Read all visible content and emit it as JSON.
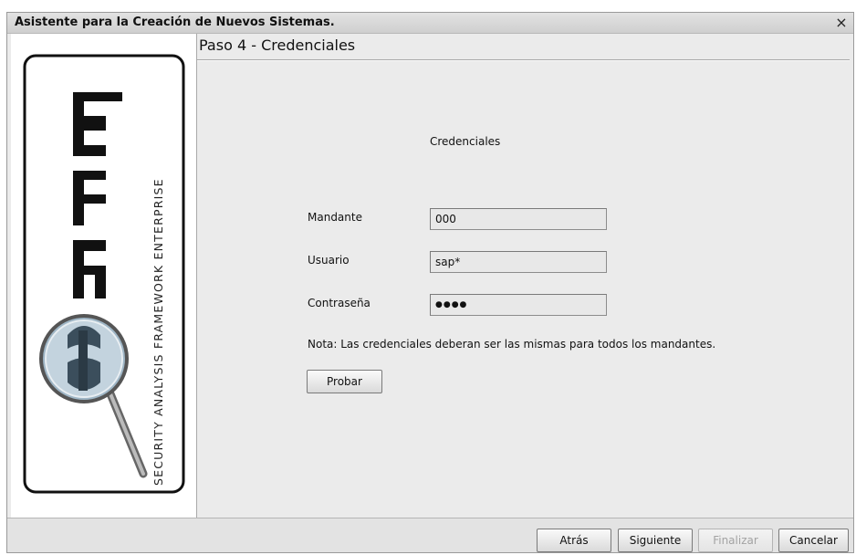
{
  "window": {
    "title": "Asistente para la Creación de Nuevos Sistemas.",
    "close_glyph": "×"
  },
  "logo": {
    "letters": "SAFE",
    "tagline": "SECURITY ANALYSIS FRAMEWORK ENTERPRISE",
    "icon": "magnifier-logo-icon"
  },
  "step": {
    "title": "Paso 4 - Credenciales"
  },
  "form": {
    "section_label": "Credenciales",
    "mandante_label": "Mandante",
    "mandante_value": "000",
    "usuario_label": "Usuario",
    "usuario_value": "sap*",
    "password_label": "Contraseña",
    "password_value": "●●●●",
    "note": "Nota: Las credenciales deberan ser las mismas para todos los mandantes.",
    "test_button": "Probar"
  },
  "footer": {
    "back": "Atrás",
    "next": "Siguiente",
    "finish": "Finalizar",
    "cancel": "Cancelar"
  }
}
